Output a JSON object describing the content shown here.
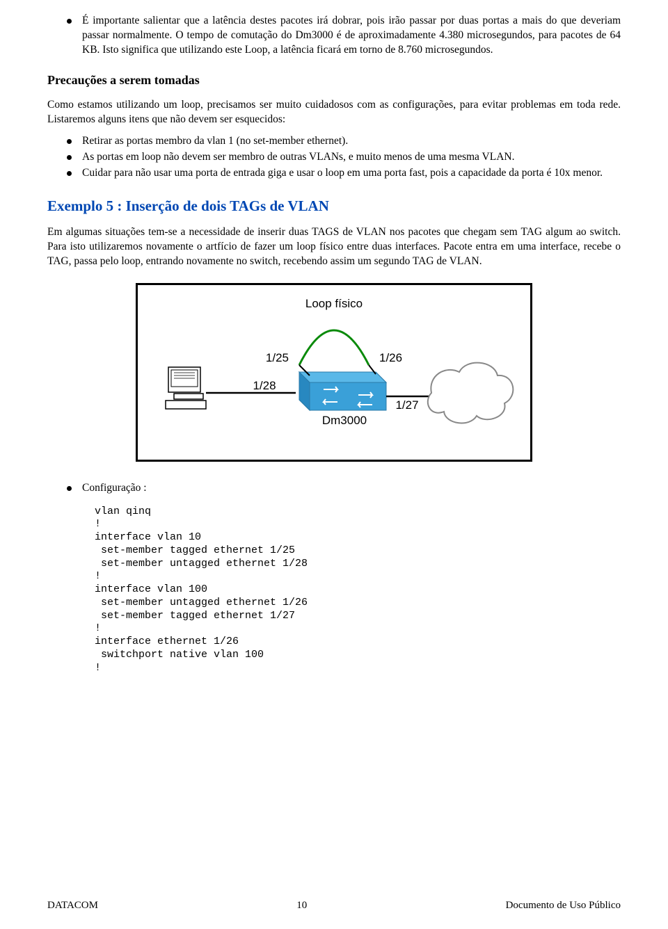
{
  "bullet1": "É importante salientar que a latência destes pacotes irá dobrar, pois irão passar por duas portas a mais do que deveriam passar normalmente. O tempo de comutação do Dm3000 é de aproximadamente 4.380 microsegundos, para pacotes de 64 KB. Isto significa que utilizando este Loop, a latência ficará em torno de 8.760 microsegundos.",
  "precautions_title": "Precauções a serem tomadas",
  "precautions_text": "Como estamos utilizando um loop, precisamos ser muito cuidadosos com as configurações, para evitar problemas em toda rede. Listaremos alguns itens que não devem ser esquecidos:",
  "precaution_items": {
    "a": "Retirar as portas membro da vlan 1 (no set-member ethernet).",
    "b": "As portas em loop não devem ser membro de outras VLANs, e muito menos de uma mesma VLAN.",
    "c": "Cuidar para não usar uma porta de entrada giga e usar o loop em uma porta fast, pois a capacidade da porta é 10x menor."
  },
  "example_title": "Exemplo 5 : Inserção de dois TAGs de VLAN",
  "example_text": "Em algumas situações tem-se a necessidade de inserir duas TAGS de VLAN nos pacotes que chegam sem TAG algum ao switch. Para isto utilizaremos novamente o artfício de fazer um loop físico entre duas interfaces. Pacote entra em uma interface, recebe o TAG, passa pelo loop, entrando novamente no switch, recebendo assim um segundo TAG de VLAN.",
  "diagram": {
    "loop_label": "Loop físico",
    "port_top_left": "1/25",
    "port_top_right": "1/26",
    "port_bottom_left": "1/28",
    "port_bottom_right": "1/27",
    "device_label": "Dm3000"
  },
  "config_label": "Configuração :",
  "config_code": "vlan qinq\n!\ninterface vlan 10\n set-member tagged ethernet 1/25\n set-member untagged ethernet 1/28\n!\ninterface vlan 100\n set-member untagged ethernet 1/26\n set-member tagged ethernet 1/27\n!\ninterface ethernet 1/26\n switchport native vlan 100\n!",
  "footer": {
    "left": "DATACOM",
    "center": "10",
    "right": "Documento de Uso Público"
  }
}
